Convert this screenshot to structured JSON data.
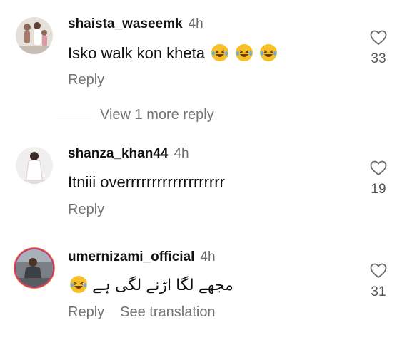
{
  "comments": [
    {
      "username": "shaista_waseemk",
      "time": "4h",
      "text": "Isko walk kon kheta",
      "emoji_count": 3,
      "likes": "33",
      "reply_label": "Reply",
      "avatar_icon": "profile-photo"
    },
    {
      "username": "shanza_khan44",
      "time": "4h",
      "text": "Itniii overrrrrrrrrrrrrrrrrrr",
      "emoji_count": 0,
      "likes": "19",
      "reply_label": "Reply",
      "avatar_icon": "profile-photo"
    },
    {
      "username": "umernizami_official",
      "time": "4h",
      "text": "مجھے لگا اڑنے لگی ہے",
      "emoji_count": 1,
      "likes": "31",
      "reply_label": "Reply",
      "translate_label": "See translation",
      "avatar_icon": "profile-photo-with-story-ring"
    }
  ],
  "view_more_replies": "View 1 more reply",
  "colors": {
    "username": "#111111",
    "secondary": "#737373",
    "story_ring": "#c13584",
    "emoji": "#f7c02b"
  }
}
